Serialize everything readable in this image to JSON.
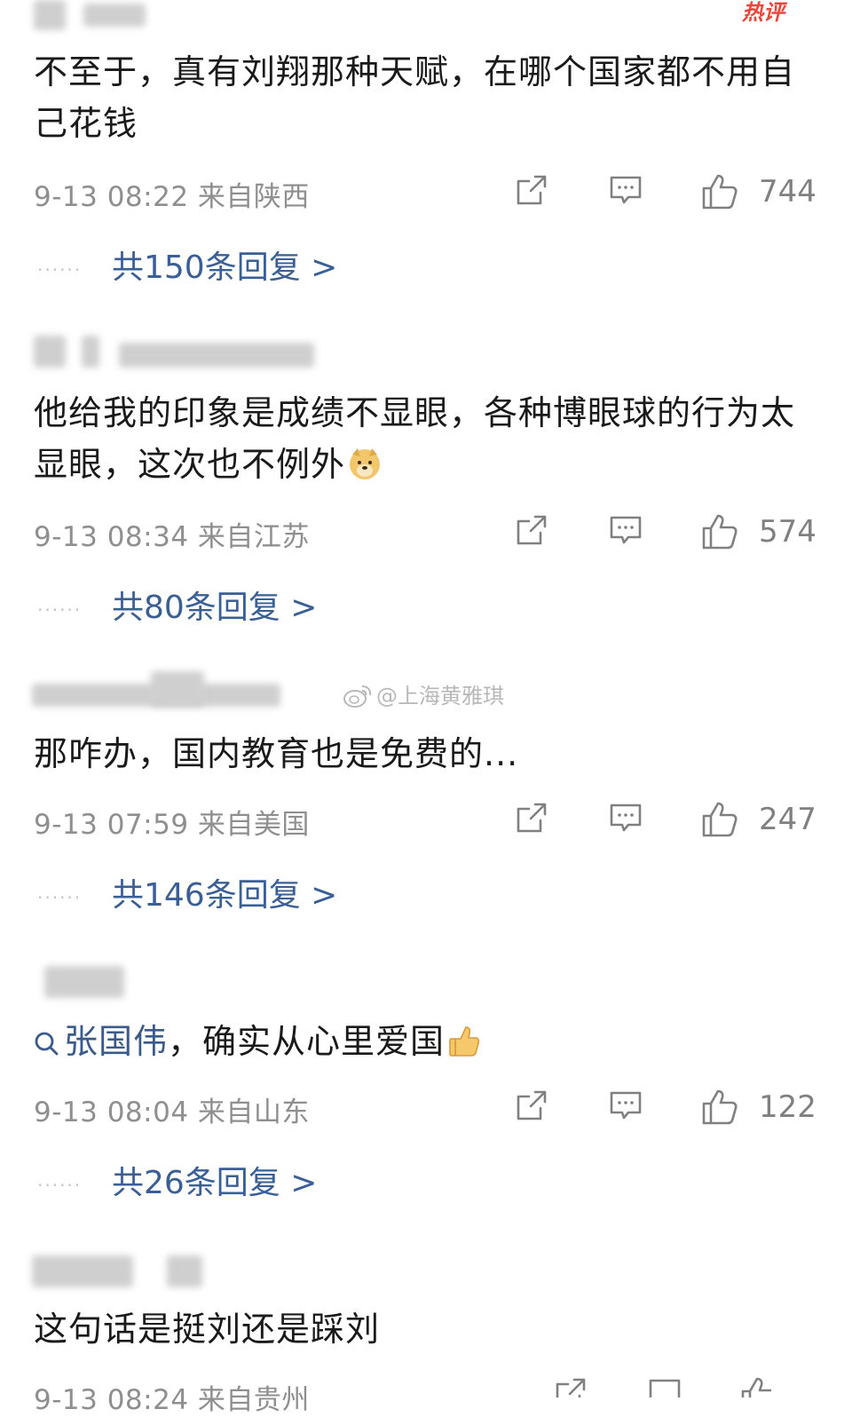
{
  "hot_badge": "热评",
  "watermark": "@上海黄雅琪",
  "comments": [
    {
      "text": "不至于，真有刘翔那种天赋，在哪个国家都不用自己花钱",
      "meta": "9-13 08:22 来自陕西",
      "likes": "744",
      "replies": "共150条回复 >"
    },
    {
      "text": "他给我的印象是成绩不显眼，各种博眼球的行为太显眼，这次也不例外",
      "meta": "9-13 08:34 来自江苏",
      "likes": "574",
      "replies": "共80条回复 >"
    },
    {
      "text": "那咋办，国内教育也是免费的...",
      "meta": "9-13 07:59 来自美国",
      "likes": "247",
      "replies": "共146条回复 >"
    },
    {
      "search_term": "张国伟",
      "text": "，确实从心里爱国",
      "meta": "9-13 08:04 来自山东",
      "likes": "122",
      "replies": "共26条回复 >"
    },
    {
      "text": "这句话是挺刘还是踩刘",
      "meta": "9-13 08:24 来自贵州"
    }
  ],
  "reply_dots": "......",
  "icons": {
    "share": "share-icon",
    "comment": "comment-icon",
    "like": "thumbs-up-icon",
    "search": "search-icon"
  }
}
